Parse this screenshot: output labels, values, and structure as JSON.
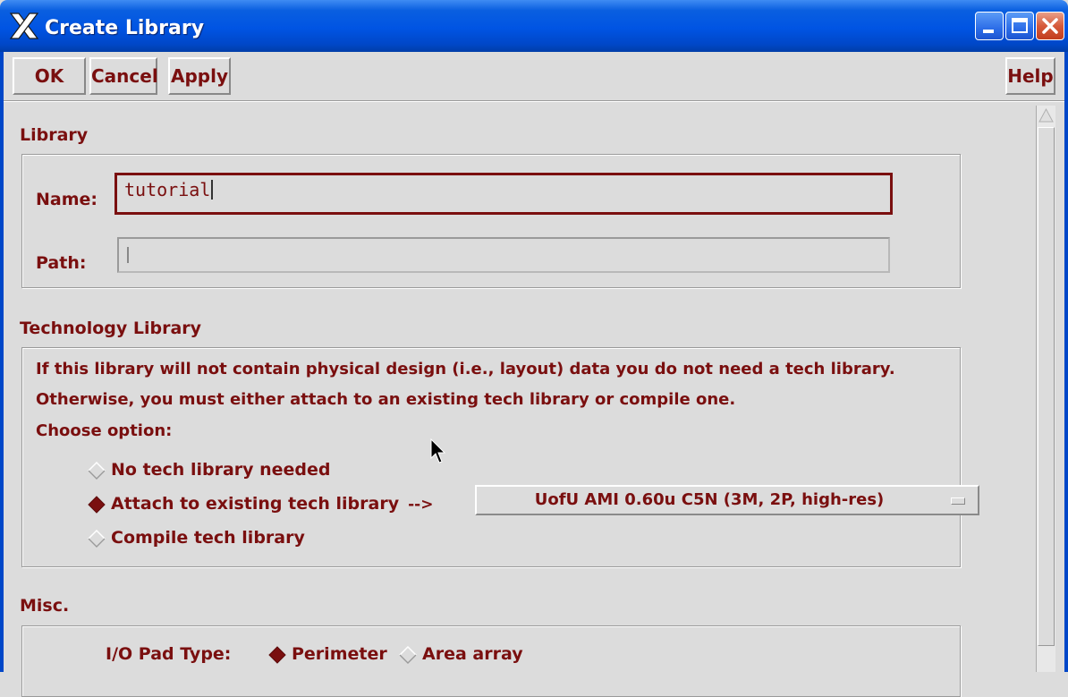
{
  "window": {
    "title": "Create Library",
    "title_color": "#ffffff",
    "titlebar_color": "#0054e3",
    "controls": {
      "minimize": "minimize-icon",
      "maximize": "maximize-icon",
      "close": "close-icon"
    }
  },
  "toolbar": {
    "ok_label": "OK",
    "cancel_label": "Cancel",
    "apply_label": "Apply",
    "help_label": "Help"
  },
  "library": {
    "section_label": "Library",
    "name_label": "Name:",
    "name_value": "tutorial",
    "path_label": "Path:",
    "path_value": ""
  },
  "technology": {
    "section_label": "Technology Library",
    "description_line1": "If this library will not contain physical design (i.e., layout) data you do not need a tech library.",
    "description_line2": "Otherwise, you must either attach to an existing tech library or compile one.",
    "choose_label": "Choose option:",
    "options": [
      {
        "label": "No tech library needed",
        "selected": false
      },
      {
        "label": "Attach to existing tech library",
        "selected": true,
        "suffix": "-->"
      },
      {
        "label": "Compile tech library",
        "selected": false
      }
    ],
    "tech_library_value": "UofU AMI 0.60u C5N (3M, 2P, high-res)"
  },
  "misc": {
    "section_label": "Misc.",
    "io_pad_label": "I/O Pad Type:",
    "io_options": [
      {
        "label": "Perimeter",
        "selected": true
      },
      {
        "label": "Area array",
        "selected": false
      }
    ]
  },
  "colors": {
    "text": "#7a0f0f",
    "background": "#dcdcdc",
    "selected_diamond": "#7a0f0f"
  }
}
